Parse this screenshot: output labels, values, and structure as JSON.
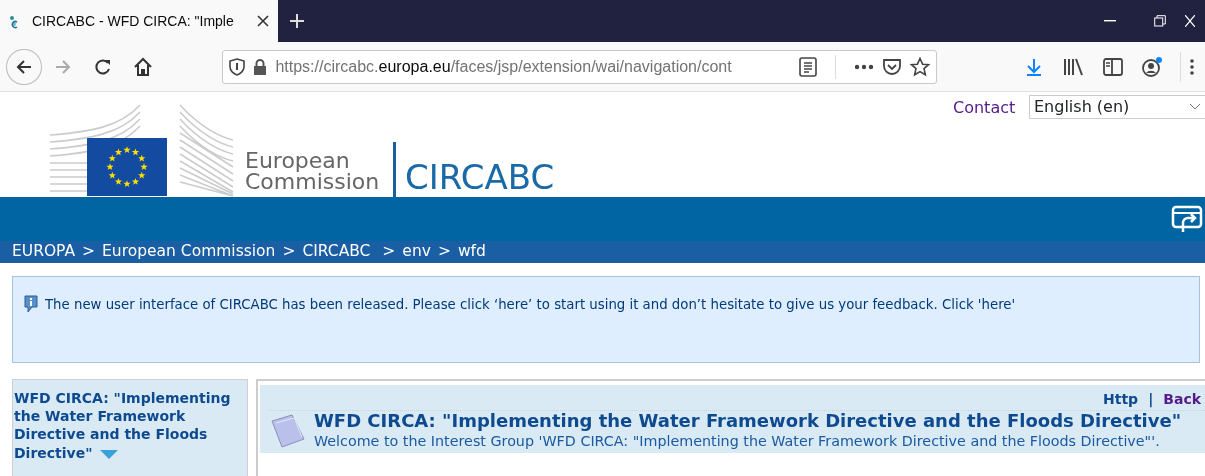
{
  "browser": {
    "tab_title": "CIRCABC - WFD CIRCA: \"Imple",
    "url": {
      "host_prefix": "https://circabc.",
      "domain": "europa.eu",
      "path": "/faces/jsp/extension/wai/navigation/cont"
    },
    "downloads_active": true,
    "account_notification": true
  },
  "header": {
    "contact_link": "Contact",
    "language": "English (en)",
    "logo_text": [
      "European",
      "Commission"
    ],
    "site_name": "CIRCABC"
  },
  "breadcrumb_separator": ">",
  "link_separator": "|",
  "breadcrumb": [
    {
      "label": "EUROPA"
    },
    {
      "label": "European Commission"
    },
    {
      "label": "CIRCABC "
    },
    {
      "label": "env"
    },
    {
      "label": "wfd"
    }
  ],
  "notice": {
    "text": "The new user interface of CIRCABC has been released. Please click ‘here’ to start using it and don’t hesitate to give us your feedback. Click 'here'"
  },
  "sidebar": {
    "group_title": "WFD CIRCA: \"Implementing the Water Framework Directive and the Floods Directive\""
  },
  "content": {
    "links": [
      {
        "label": "Http",
        "visited": false
      },
      {
        "label": "Back",
        "visited": true
      }
    ],
    "title": "WFD CIRCA: \"Implementing the Water Framework Directive and the Floods Directive\"",
    "welcome": "Welcome to the Interest Group 'WFD CIRCA: \"Implementing the Water Framework Directive and the Floods Directive\"'."
  }
}
